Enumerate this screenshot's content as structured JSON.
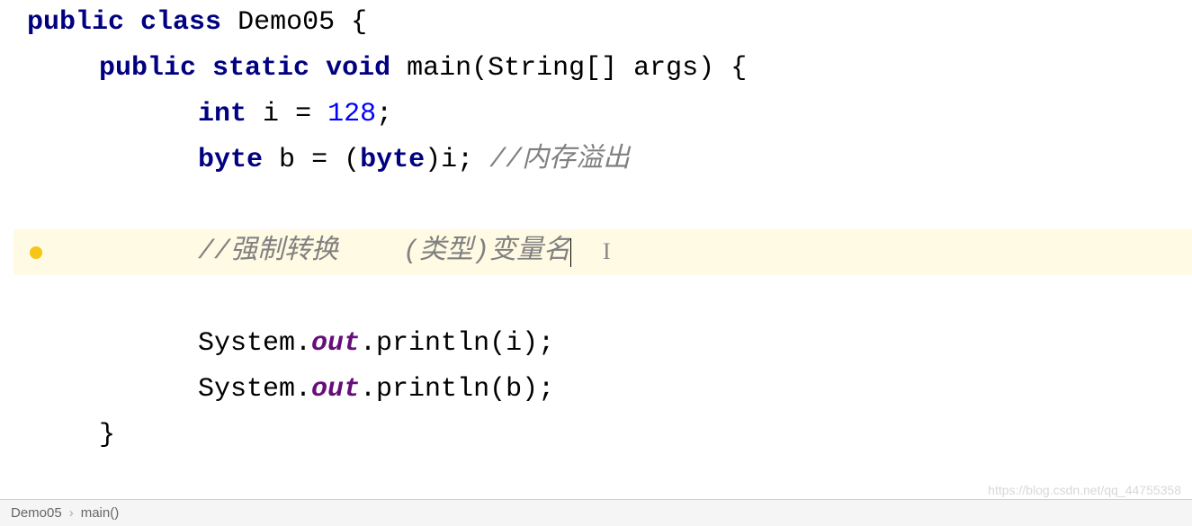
{
  "code": {
    "line1": {
      "kw1": "public",
      "kw2": "class",
      "cls": "Demo05",
      "brace": "{"
    },
    "line2": {
      "kw1": "public",
      "kw2": "static",
      "kw3": "void",
      "method": "main",
      "params": "(String[] args)",
      "brace": "{"
    },
    "line3": {
      "kw": "int",
      "var": "i",
      "eq": "=",
      "val": "128",
      "semi": ";"
    },
    "line4": {
      "kw": "byte",
      "var": "b",
      "eq": "=",
      "cast_open": "(",
      "cast_type": "byte",
      "cast_close": ")i;",
      "comment": "//内存溢出"
    },
    "line6": {
      "comment": "//强制转换    (类型)变量名"
    },
    "line8": {
      "sys": "System.",
      "out": "out",
      "print": ".println(i);"
    },
    "line9": {
      "sys": "System.",
      "out": "out",
      "print": ".println(b);"
    },
    "line10": {
      "brace": "}"
    }
  },
  "breadcrumb": {
    "item1": "Demo05",
    "item2": "main()"
  },
  "watermark": "https://blog.csdn.net/qq_44755358"
}
